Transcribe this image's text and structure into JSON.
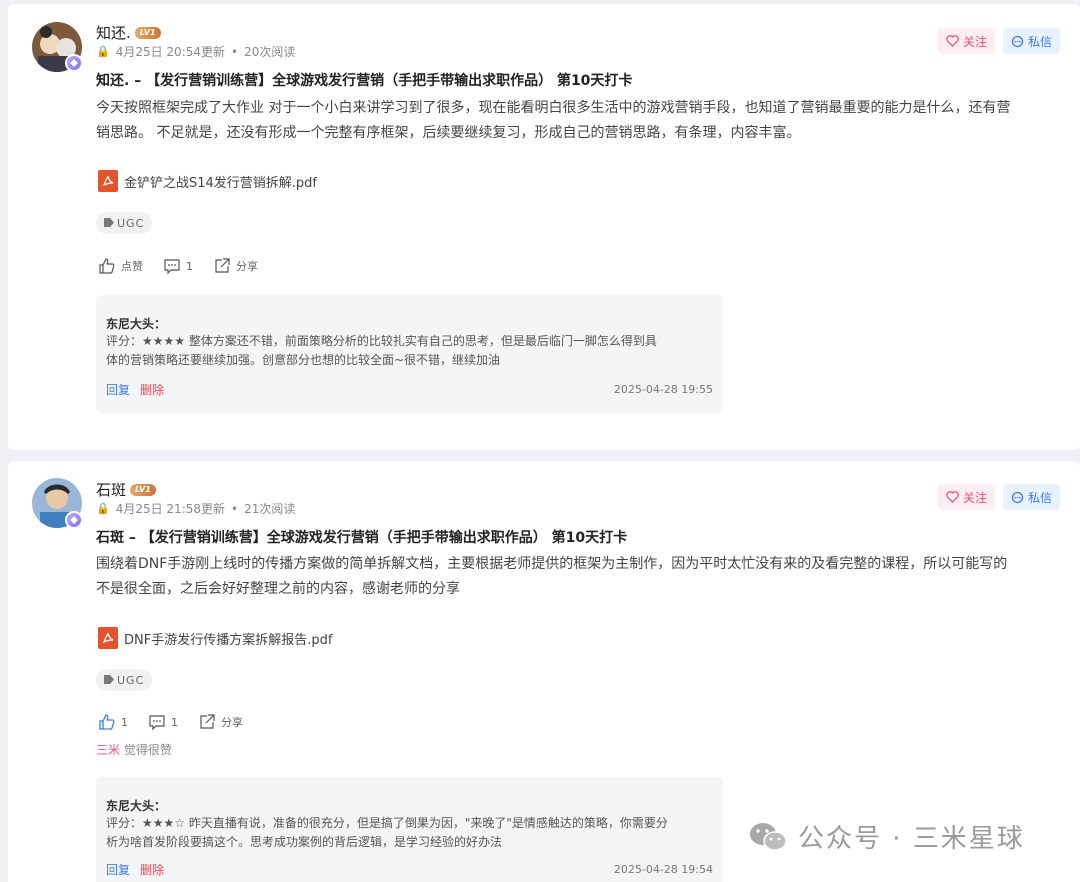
{
  "posts": [
    {
      "username": "知还.",
      "level": "LV1",
      "meta_updated": "4月25日 20:54更新",
      "meta_reads": "20次阅读",
      "follow_label": "关注",
      "message_label": "私信",
      "title": "知还. – 【发行营销训练营】全球游戏发行营销（手把手带输出求职作品） 第10天打卡",
      "body_line1": "今天按照框架完成了大作业 对于一个小白来讲学习到了很多，现在能看明白很多生活中的游戏营销手段，也知道了营销最重要的能力是什么，还有营",
      "body_line2": "销思路。 不足就是，还没有形成一个完整有序框架，后续要继续复习，形成自己的营销思路，有条理，内容丰富。",
      "file_name": "金铲铲之战S14发行营销拆解.pdf",
      "tag": "UGC",
      "like_label": "点赞",
      "comment_count": "1",
      "share_label": "分享",
      "comment": {
        "author": "东尼大头：",
        "line1": "评分：★★★★ 整体方案还不错，前面策略分析的比较扎实有自己的思考，但是最后临门一脚怎么得到具",
        "line2": "体的营销策略还要继续加强。创意部分也想的比较全面~很不错，继续加油",
        "reply_label": "回复",
        "delete_label": "删除",
        "time": "2025-04-28 19:55"
      }
    },
    {
      "username": "石斑",
      "level": "LV1",
      "meta_updated": "4月25日 21:58更新",
      "meta_reads": "21次阅读",
      "follow_label": "关注",
      "message_label": "私信",
      "title": "石斑 – 【发行营销训练营】全球游戏发行营销（手把手带输出求职作品） 第10天打卡",
      "body_line1": "围绕着DNF手游刚上线时的传播方案做的简单拆解文档，主要根据老师提供的框架为主制作，因为平时太忙没有来的及看完整的课程，所以可能写的",
      "body_line2": "不是很全面，之后会好好整理之前的内容，感谢老师的分享",
      "file_name": "DNF手游发行传播方案拆解报告.pdf",
      "tag": "UGC",
      "like_count": "1",
      "comment_count": "1",
      "share_label": "分享",
      "liked_by_user": "三米",
      "liked_by_suffix": " 觉得很赞",
      "comment": {
        "author": "东尼大头：",
        "line1": "评分：★★★☆ 昨天直播有说，准备的很充分，但是搞了倒果为因，\"来晚了\"是情感触达的策略，你需要分",
        "line2": "析为啥首发阶段要搞这个。思考成功案例的背后逻辑，是学习经验的好办法",
        "reply_label": "回复",
        "delete_label": "删除",
        "time": "2025-04-28 19:54"
      }
    }
  ],
  "watermark": "公众号 · 三米星球",
  "colors": {
    "follow": "#e8557a",
    "message": "#3c7de0",
    "delete": "#e84848",
    "pdf": "#e2542b",
    "like_active": "#3c7de0"
  }
}
